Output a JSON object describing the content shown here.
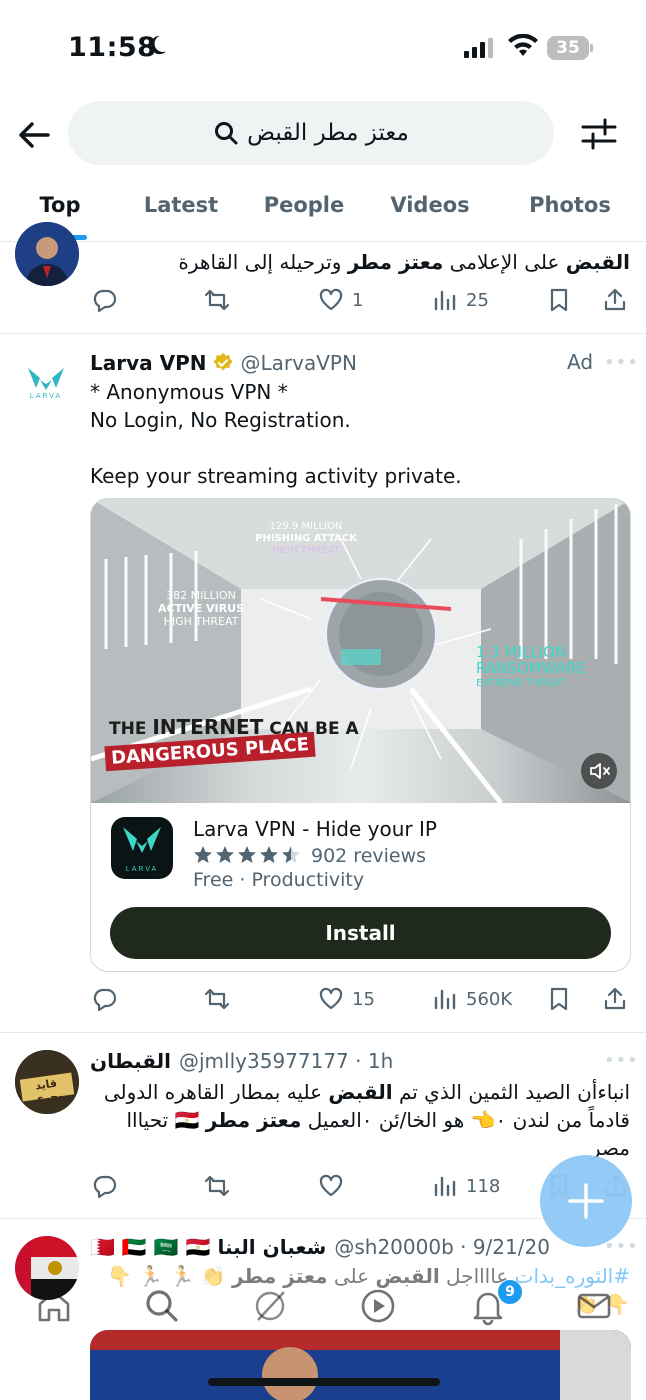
{
  "status_bar": {
    "time": "11:58",
    "battery": "35"
  },
  "search": {
    "query": "معتز مطر القبض"
  },
  "tabs": [
    {
      "label": "Top",
      "active": true
    },
    {
      "label": "Latest"
    },
    {
      "label": "People"
    },
    {
      "label": "Videos"
    },
    {
      "label": "Photos"
    }
  ],
  "tweet1": {
    "text_a": "القبض",
    "text_b": " على الإعلامى ",
    "text_c": "معتز مطر",
    "text_d": " وترحيله إلى القاهرة",
    "likes": "1",
    "views": "25"
  },
  "ad": {
    "name": "Larva VPN",
    "handle": "@LarvaVPN",
    "ad_label": "Ad",
    "line1": "* Anonymous VPN *",
    "line2": "No Login, No Registration.",
    "line3": "Keep your streaming activity private.",
    "logo_text": "LARVA",
    "media": {
      "stat1_value": "129.9 MILLION",
      "stat1_label": "PHISHING ATTACK",
      "stat1_sub": "HIGH THREAT",
      "stat2_value": "382 MILLION",
      "stat2_label": "ACTIVE VIRUS",
      "stat2_sub": "HIGH THREAT",
      "stat3_value": "1.3 MILLION",
      "stat3_label": "RANSOMWARE",
      "stat3_sub": "EXTREME THREAT",
      "headline_a": "THE ",
      "headline_b": "INTERNET",
      "headline_c": " CAN BE A",
      "headline_d": "DANGEROUS PLACE"
    },
    "app_title": "Larva VPN - Hide your IP",
    "rating_stars": 4.5,
    "reviews": "902 reviews",
    "meta": "Free · Productivity",
    "install_label": "Install",
    "retweets": "",
    "likes": "15",
    "views": "560K"
  },
  "tweet2": {
    "name": "القبطان",
    "handle": "@jmlly35977177 · 1h",
    "line1_a": "انباءأن الصيد الثمين الذي تم ",
    "line1_b": "القبض",
    "line1_c": " عليه بمطار القاهره الدولى",
    "line2_a": "قادماً من لندن ٠",
    "line2_b": "👈",
    "line2_c": " هو الخا/ئن ٠العميل ",
    "line2_d": "معتز مطر",
    "line2_e": " 🇪🇬 تحيااا",
    "line3": "مصر",
    "avatar_text": "قايد بحري",
    "views": "118"
  },
  "tweet3": {
    "name": "شعبان البنا 🇧🇭 🇦🇪 🇸🇦 🇪🇬",
    "handle": "@sh20000b · 9/21/20",
    "text_a": "#الثوره_بدات",
    "text_b": " عااااجل ",
    "text_c": "القبض",
    "text_d": " على ",
    "text_e": "معتز مطر",
    "text_f": " 👏 🏃 🏃 👇 👇 👏"
  },
  "bottom_nav": {
    "notifications_badge": "9"
  },
  "colors": {
    "accent": "#1d9bf0",
    "install_bg": "#1f2a1c",
    "verified": "#e2b719",
    "media_teal": "#3fd6c8",
    "danger_red": "#b8202c"
  }
}
